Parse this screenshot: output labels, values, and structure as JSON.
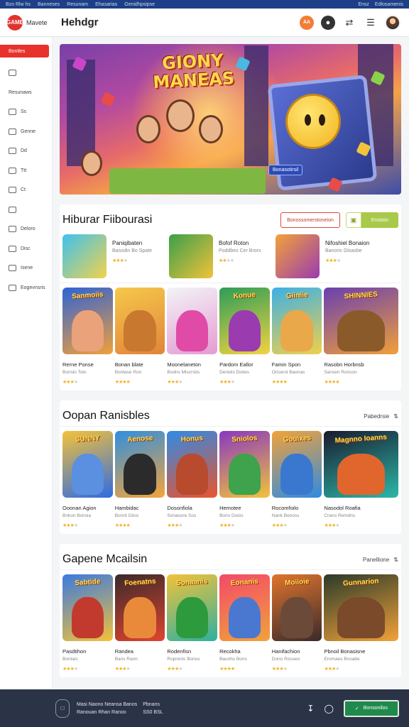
{
  "topbar": {
    "links": [
      "Bzo Rlw hs",
      "Banneses",
      "Resunam",
      "Ehasarias",
      "Genidhpsipse"
    ],
    "right": [
      "Ensz",
      "Edlosamenis"
    ]
  },
  "header": {
    "logo_mark": "GAME",
    "logo_text": "Mavete",
    "title": "Hehdgr",
    "orange_badge": "AA",
    "icons": [
      "fire-icon",
      "share-icon",
      "bars-icon",
      "list-icon"
    ]
  },
  "sidebar": {
    "items": [
      {
        "label": "Bontles",
        "active": true,
        "icon": "home-icon"
      },
      {
        "label": "",
        "icon": "compass-icon"
      },
      {
        "label": "Resunaws",
        "icon": "none"
      },
      {
        "label": "Ss",
        "icon": "box-icon"
      },
      {
        "label": "Genne",
        "icon": "monitor-icon"
      },
      {
        "label": "Dd",
        "icon": "grid-icon"
      },
      {
        "label": "Ttt",
        "icon": "menu-icon"
      },
      {
        "label": "Ct",
        "icon": "tag-icon"
      },
      {
        "label": "",
        "icon": "calendar-icon"
      },
      {
        "label": "Deloro",
        "icon": "chat-icon"
      },
      {
        "label": "Disc",
        "icon": "image-icon"
      },
      {
        "label": "Isene",
        "icon": "gauge-icon"
      },
      {
        "label": "Eogevnsris",
        "icon": "controller-icon"
      }
    ]
  },
  "hero": {
    "title_line1": "GIONY",
    "title_line2": "MANEAS",
    "badge": "Bonasotirsil"
  },
  "sections": [
    {
      "title": "Hiburar Fiibourasi",
      "btn_outline": "Bonossomerstoneion",
      "btn_green": "Eroston",
      "featured": [
        {
          "name": "Paniqibaten",
          "sub": "Basodin Bo Spate",
          "rating": 3
        },
        {
          "name": "Bofof Roton",
          "sub": "Poddbes Cer Brors",
          "rating": 2
        },
        {
          "name": "Nifoshiel Bonaion",
          "sub": "Banoris Gloasbe",
          "rating": 3
        }
      ],
      "cards": [
        {
          "art": "Sanmoiis",
          "name": "Rerne Ponse",
          "sub": "Bonslo Tolo",
          "rating": 3,
          "c1": "#2e63d6",
          "c2": "#f0a03a",
          "fig": "#e9a27a"
        },
        {
          "art": "",
          "name": "Bonan blate",
          "sub": "Bontase Ron",
          "rating": 4,
          "c1": "#f5c84a",
          "c2": "#e2843a",
          "fig": "#c8782f"
        },
        {
          "art": "",
          "name": "Moonelaneton",
          "sub": "Bodns Miscrsbs",
          "rating": 3,
          "c1": "#f3f3f7",
          "c2": "#e49bd3",
          "fig": "#e04ba7"
        },
        {
          "art": "Konue",
          "name": "Pardom Eallor",
          "sub": "Deniels Diotes",
          "rating": 3,
          "c1": "#2d9d58",
          "c2": "#f2d340",
          "fig": "#9a3bb0"
        },
        {
          "art": "Giiniie",
          "name": "Famin Spon",
          "sub": "Oriserst Baonas",
          "rating": 4,
          "c1": "#3db0e6",
          "c2": "#f0d04a",
          "fig": "#e9a84a"
        },
        {
          "art": "SHINNIES",
          "name": "Rasobn Horbnsb",
          "sub": "Sansen Ronson",
          "rating": 4,
          "c1": "#6a3fb0",
          "c2": "#f0a03a",
          "fig": "#8a5a2a"
        }
      ]
    },
    {
      "title": "Oopan Ranisbles",
      "see_all": "Pabedrsie",
      "cards": [
        {
          "art": "SUNNY",
          "name": "Ooonan Agion",
          "sub": "Bnkon Bonsia",
          "rating": 3,
          "c1": "#f4c23a",
          "c2": "#2f6be0",
          "fig": "#5b8fe0"
        },
        {
          "art": "Aenose",
          "name": "Hambidac",
          "sub": "Bonnt Giios",
          "rating": 4,
          "c1": "#2f8fe0",
          "c2": "#f4a43a",
          "fig": "#2b2b2b"
        },
        {
          "art": "Honus",
          "name": "Dosonfiola",
          "sub": "Sonasore Sos",
          "rating": 3,
          "c1": "#2f8be6",
          "c2": "#e8542e",
          "fig": "#b84a2e"
        },
        {
          "art": "Sniolos",
          "name": "Hemotee",
          "sub": "Borio Doios",
          "rating": 3,
          "c1": "#8a38c0",
          "c2": "#f2c23a",
          "fig": "#3fa24c"
        },
        {
          "art": "Gouixes",
          "name": "Rocomfoilo",
          "sub": "Nank Benoss",
          "rating": 3,
          "c1": "#f2a23a",
          "c2": "#2f8be0",
          "fig": "#3a78d0"
        },
        {
          "art": "Magnno Ioanns",
          "name": "Nasodol Roafia",
          "sub": "Crano Remdns",
          "rating": 3,
          "c1": "#1a1a2e",
          "c2": "#2bb8a8",
          "fig": "#e0662e"
        }
      ]
    },
    {
      "title": "Gapene Mcailsin",
      "see_all": "Panellione",
      "cards": [
        {
          "art": "Sabtide",
          "name": "Pasdtihon",
          "sub": "Bontais",
          "rating": 3,
          "c1": "#3b7ae0",
          "c2": "#f2c23a",
          "fig": "#c23a2e"
        },
        {
          "art": "Foenatns",
          "name": "Randea",
          "sub": "Bans Rann",
          "rating": 3,
          "c1": "#3a2a2a",
          "c2": "#e0442e",
          "fig": "#e98a3a"
        },
        {
          "art": "Sonaanis",
          "name": "Rodenfisn",
          "sub": "Roprenis Bonos",
          "rating": 3,
          "c1": "#f2c23a",
          "c2": "#2fb0a0",
          "fig": "#2e9a3e"
        },
        {
          "art": "Eonanis",
          "name": "Recokha",
          "sub": "Baunhs Bons",
          "rating": 4,
          "c1": "#f24a6a",
          "c2": "#f2a23a",
          "fig": "#4a78d0"
        },
        {
          "art": "Moiioie",
          "name": "Hanifachion",
          "sub": "Dono Rosseo",
          "rating": 3,
          "c1": "#e0742e",
          "c2": "#3a2a2a",
          "fig": "#6b4a3a"
        },
        {
          "art": "Gunnarion",
          "name": "Pbnoil Bonasisne",
          "sub": "Eromaes Bnoabe",
          "rating": 3,
          "c1": "#2a3a2a",
          "c2": "#f2a23a",
          "fig": "#7a4a2a"
        }
      ]
    }
  ],
  "footer": {
    "line1": "Masi Naono Neansa Banos",
    "line2": "Ranouan Rhan Ranoo",
    "col2_line1": "Pbnans",
    "col2_line2": "SS0 BSL",
    "btn": "Bonsonilos"
  },
  "colors": {
    "accent": "#e8332d",
    "topbar": "#1d3f87",
    "footer": "#2b3347",
    "green_btn": "#a8c94a",
    "star": "#f2b01e"
  }
}
